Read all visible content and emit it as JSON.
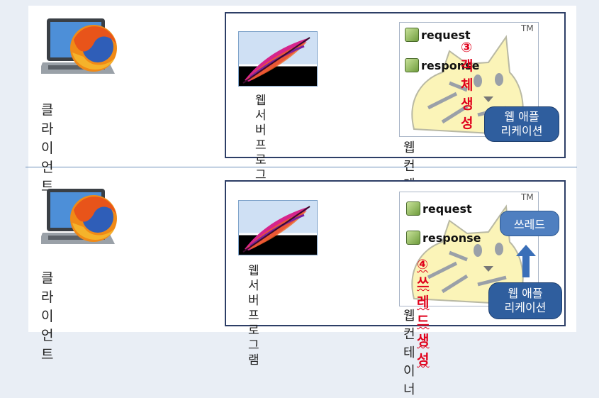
{
  "colors": {
    "container_border": "#2d3e66",
    "pill_bg": "#2f5e9e",
    "step_red": "#e0001b",
    "divider": "#6b8fb8"
  },
  "top": {
    "client_label": "클라이언트",
    "server_label_line1": "웹 서버",
    "server_label_line2": "프로그램",
    "request_label": "request",
    "response_label": "response",
    "step_text": "③객체생성",
    "app_line1": "웹 애플",
    "app_line2": "리케이션",
    "container_label": "웹 컨테이너",
    "tm": "TM"
  },
  "bottom": {
    "client_label": "클라이언트",
    "server_label_line1": "웹 서버",
    "server_label_line2": "프로그램",
    "request_label": "request",
    "response_label": "response",
    "thread_label": "쓰레드",
    "step_text": "④쓰레드생성",
    "app_line1": "웹 애플",
    "app_line2": "리케이션",
    "container_label": "웹 컨테이너",
    "tm": "TM"
  },
  "icons": {
    "client": "firefox-laptop-icon",
    "server": "apache-feather-icon",
    "container": "tomcat-icon",
    "object": "object-square-icon",
    "arrow": "arrow-up-icon"
  }
}
